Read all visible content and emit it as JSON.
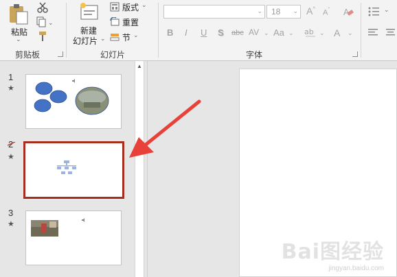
{
  "ribbon": {
    "clipboard": {
      "paste_label": "粘贴",
      "group_label": "剪贴板"
    },
    "slides": {
      "new_slide_label": "新建",
      "new_slide_label_2": "幻灯片",
      "layout_label": "版式",
      "reset_label": "重置",
      "section_label": "节",
      "group_label": "幻灯片"
    },
    "font": {
      "font_name_value": "",
      "font_size_value": "18",
      "bold": "B",
      "italic": "I",
      "underline": "U",
      "shadow": "S",
      "strike": "abc",
      "spacing": "AV",
      "case": "Aa",
      "grow": "A",
      "shrink": "A",
      "color": "A",
      "group_label": "字体"
    }
  },
  "thumbnails": [
    {
      "number": "1",
      "star": "★"
    },
    {
      "number": "2",
      "star": "★"
    },
    {
      "number": "3",
      "star": "★"
    }
  ],
  "watermark": {
    "line1": "Bai图经验",
    "line2": "jingyan.baidu.com"
  },
  "colors": {
    "selection_border": "#a62e1e",
    "arrow": "#e8413a",
    "shape_fill": "#4472c4"
  }
}
